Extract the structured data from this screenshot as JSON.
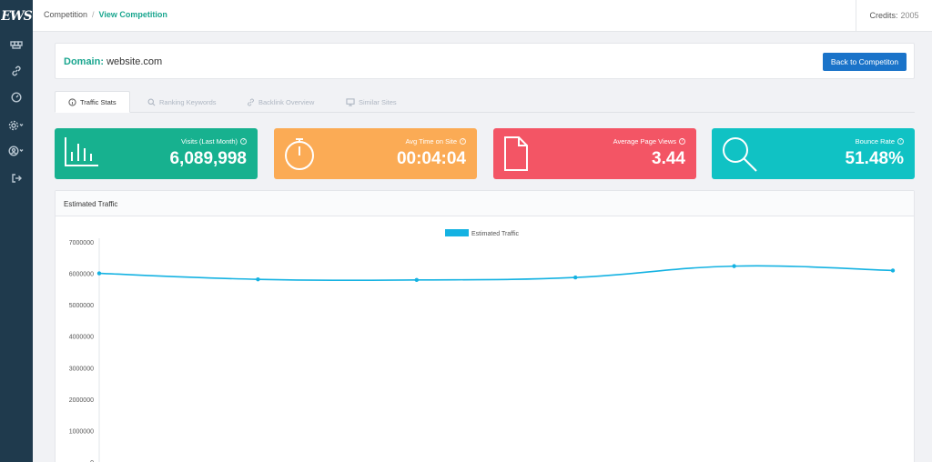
{
  "app": {
    "logo_text": "EWS"
  },
  "sidebar": {
    "items": [
      {
        "name": "dashboard-icon"
      },
      {
        "name": "link-icon"
      },
      {
        "name": "speedometer-icon"
      },
      {
        "name": "settings-icon"
      },
      {
        "name": "user-icon"
      },
      {
        "name": "logout-icon"
      }
    ]
  },
  "breadcrumb": {
    "parent": "Competition",
    "separator": "/",
    "current": "View Competition"
  },
  "credits": {
    "label": "Credits:",
    "value": "2005"
  },
  "domain": {
    "label": "Domain:",
    "value": "website.com",
    "back_button": "Back to Competiton"
  },
  "tabs": [
    {
      "label": "Traffic Stats",
      "icon": "info-icon",
      "active": true
    },
    {
      "label": "Ranking Keywords",
      "icon": "search-icon",
      "active": false
    },
    {
      "label": "Backlink Overview",
      "icon": "link-icon",
      "active": false
    },
    {
      "label": "Similar Sites",
      "icon": "monitor-icon",
      "active": false
    }
  ],
  "stats": [
    {
      "title": "Visits (Last Month)",
      "value": "6,089,998",
      "color": "#17b18f",
      "icon": "bar-chart-icon"
    },
    {
      "title": "Avg Time on Site",
      "value": "00:04:04",
      "color": "#fbab55",
      "icon": "stopwatch-icon"
    },
    {
      "title": "Average Page Views",
      "value": "3.44",
      "color": "#f35565",
      "icon": "document-icon"
    },
    {
      "title": "Bounce Rate",
      "value": "51.48%",
      "color": "#10c2c4",
      "icon": "search-icon"
    }
  ],
  "chart_panel": {
    "title": "Estimated Traffic"
  },
  "chart_data": {
    "type": "line",
    "title": "",
    "xlabel": "",
    "ylabel": "",
    "ylim": [
      0,
      7000000
    ],
    "yticks": [
      "7000000",
      "6000000",
      "5000000",
      "4000000",
      "3000000",
      "2000000",
      "1000000",
      "0"
    ],
    "legend_position": "top-center",
    "color": "#14b2e2",
    "series": [
      {
        "name": "Estimated Traffic",
        "values": [
          6000000,
          5810000,
          5790000,
          5870000,
          6230000,
          6090000
        ]
      }
    ]
  }
}
